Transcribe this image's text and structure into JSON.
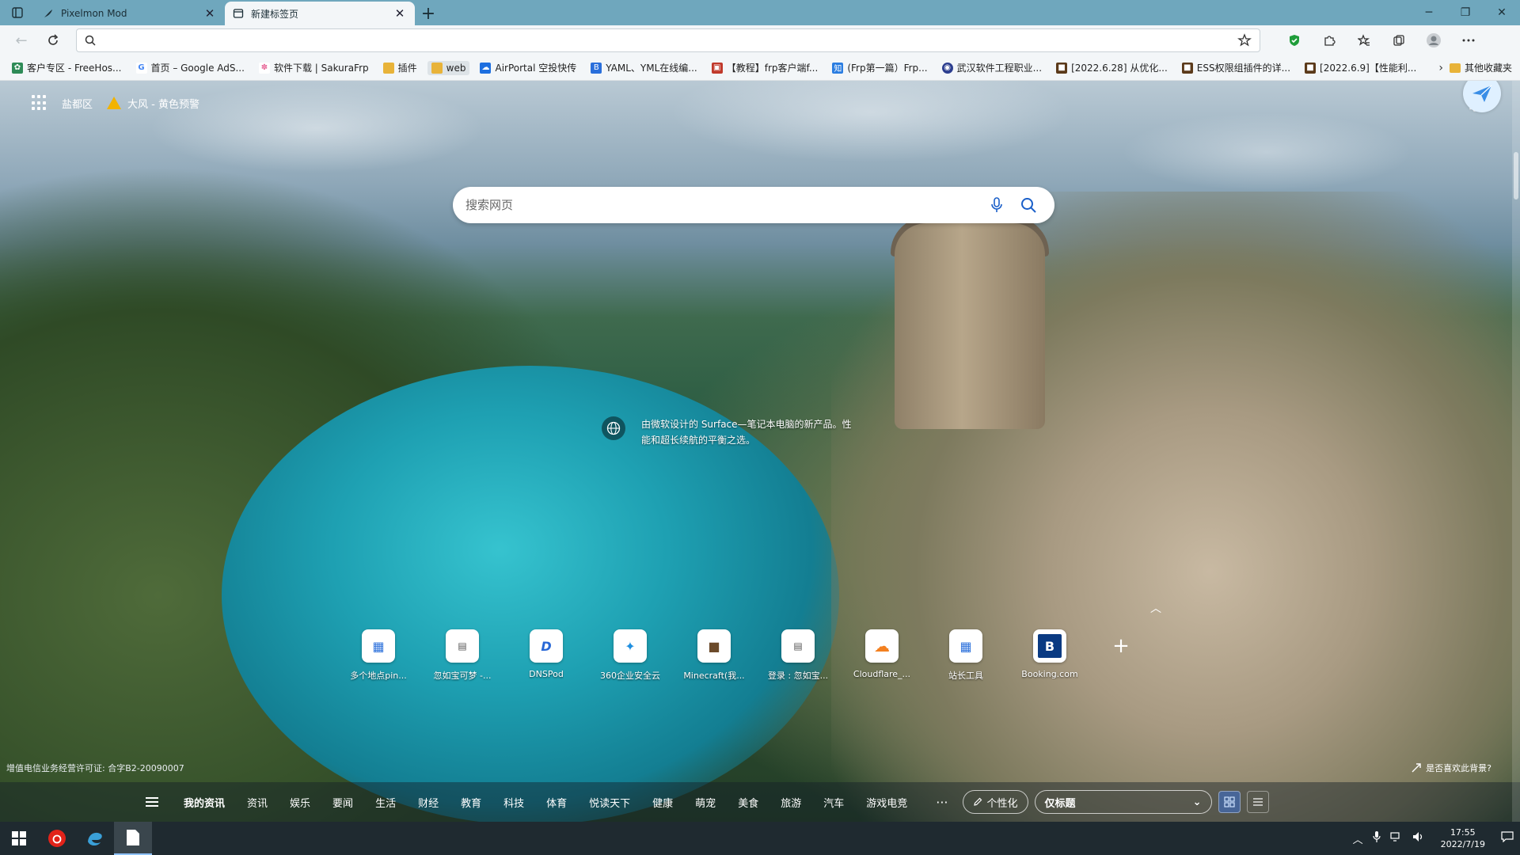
{
  "tabs": [
    {
      "title": "Pixelmon Mod",
      "active": false
    },
    {
      "title": "新建标签页",
      "active": true
    }
  ],
  "address": {
    "value": "",
    "placeholder": ""
  },
  "bookmarks": [
    {
      "label": "客户专区 - FreeHos...",
      "color": "#2e8b57"
    },
    {
      "label": "首页 – Google AdS...",
      "color": "#4285f4"
    },
    {
      "label": "软件下载 | SakuraFrp",
      "color": "#e76b9a"
    },
    {
      "label": "插件",
      "color": "#e8b339"
    },
    {
      "label": "web",
      "color": "#e8b339"
    },
    {
      "label": "AirPortal 空投快传",
      "color": "#1d6fe0"
    },
    {
      "label": "YAML、YML在线编...",
      "color": "#2a6fdb"
    },
    {
      "label": "【教程】frp客户端f...",
      "color": "#c0392b"
    },
    {
      "label": "(Frp第一篇）Frp...",
      "color": "#2a7de1"
    },
    {
      "label": "武汉软件工程职业...",
      "color": "#2c3e8f"
    },
    {
      "label": "[2022.6.28] 从优化...",
      "color": "#5b3a1a"
    },
    {
      "label": "ESS权限组插件的详...",
      "color": "#5b3a1a"
    },
    {
      "label": "[2022.6.9]【性能利...",
      "color": "#5b3a1a"
    }
  ],
  "other_bookmarks": "其他收藏夹",
  "ntp": {
    "location": "盐都区",
    "weather_alert": "大风 - 黄色预警",
    "search_placeholder": "搜索网页",
    "image_info": "由微软设计的 Surface—笔记本电脑的新产品。性能和超长续航的平衡之选。",
    "license": "增值电信业务经营许可证: 合字B2-20090007",
    "like_background": "是否喜欢此背景?"
  },
  "quick_links": [
    {
      "label": "多个地点pin...",
      "glyph": "▦",
      "color": "#2a6fdb"
    },
    {
      "label": "忽如宝可梦 -...",
      "glyph": "▤",
      "color": "#555"
    },
    {
      "label": "DNSPod",
      "glyph": "D",
      "color": "#2767d6"
    },
    {
      "label": "360企业安全云",
      "glyph": "✦",
      "color": "#1f8fe0"
    },
    {
      "label": "Minecraft(我...",
      "glyph": "■",
      "color": "#6b4a2a"
    },
    {
      "label": "登录 : 忽如宝...",
      "glyph": "▤",
      "color": "#555"
    },
    {
      "label": "Cloudflare_...",
      "glyph": "☁",
      "color": "#f38020"
    },
    {
      "label": "站长工具",
      "glyph": "▦",
      "color": "#2a6fdb"
    },
    {
      "label": "Booking.com",
      "glyph": "B",
      "color": "#0a3a82"
    }
  ],
  "news": {
    "tabs": [
      "我的资讯",
      "资讯",
      "娱乐",
      "要闻",
      "生活",
      "财经",
      "教育",
      "科技",
      "体育",
      "悦读天下",
      "健康",
      "萌宠",
      "美食",
      "旅游",
      "汽车",
      "游戏电竞"
    ],
    "more": "···",
    "personalize": "个性化",
    "layout_value": "仅标题"
  },
  "taskbar": {
    "time": "17:55",
    "date": "2022/7/19"
  }
}
